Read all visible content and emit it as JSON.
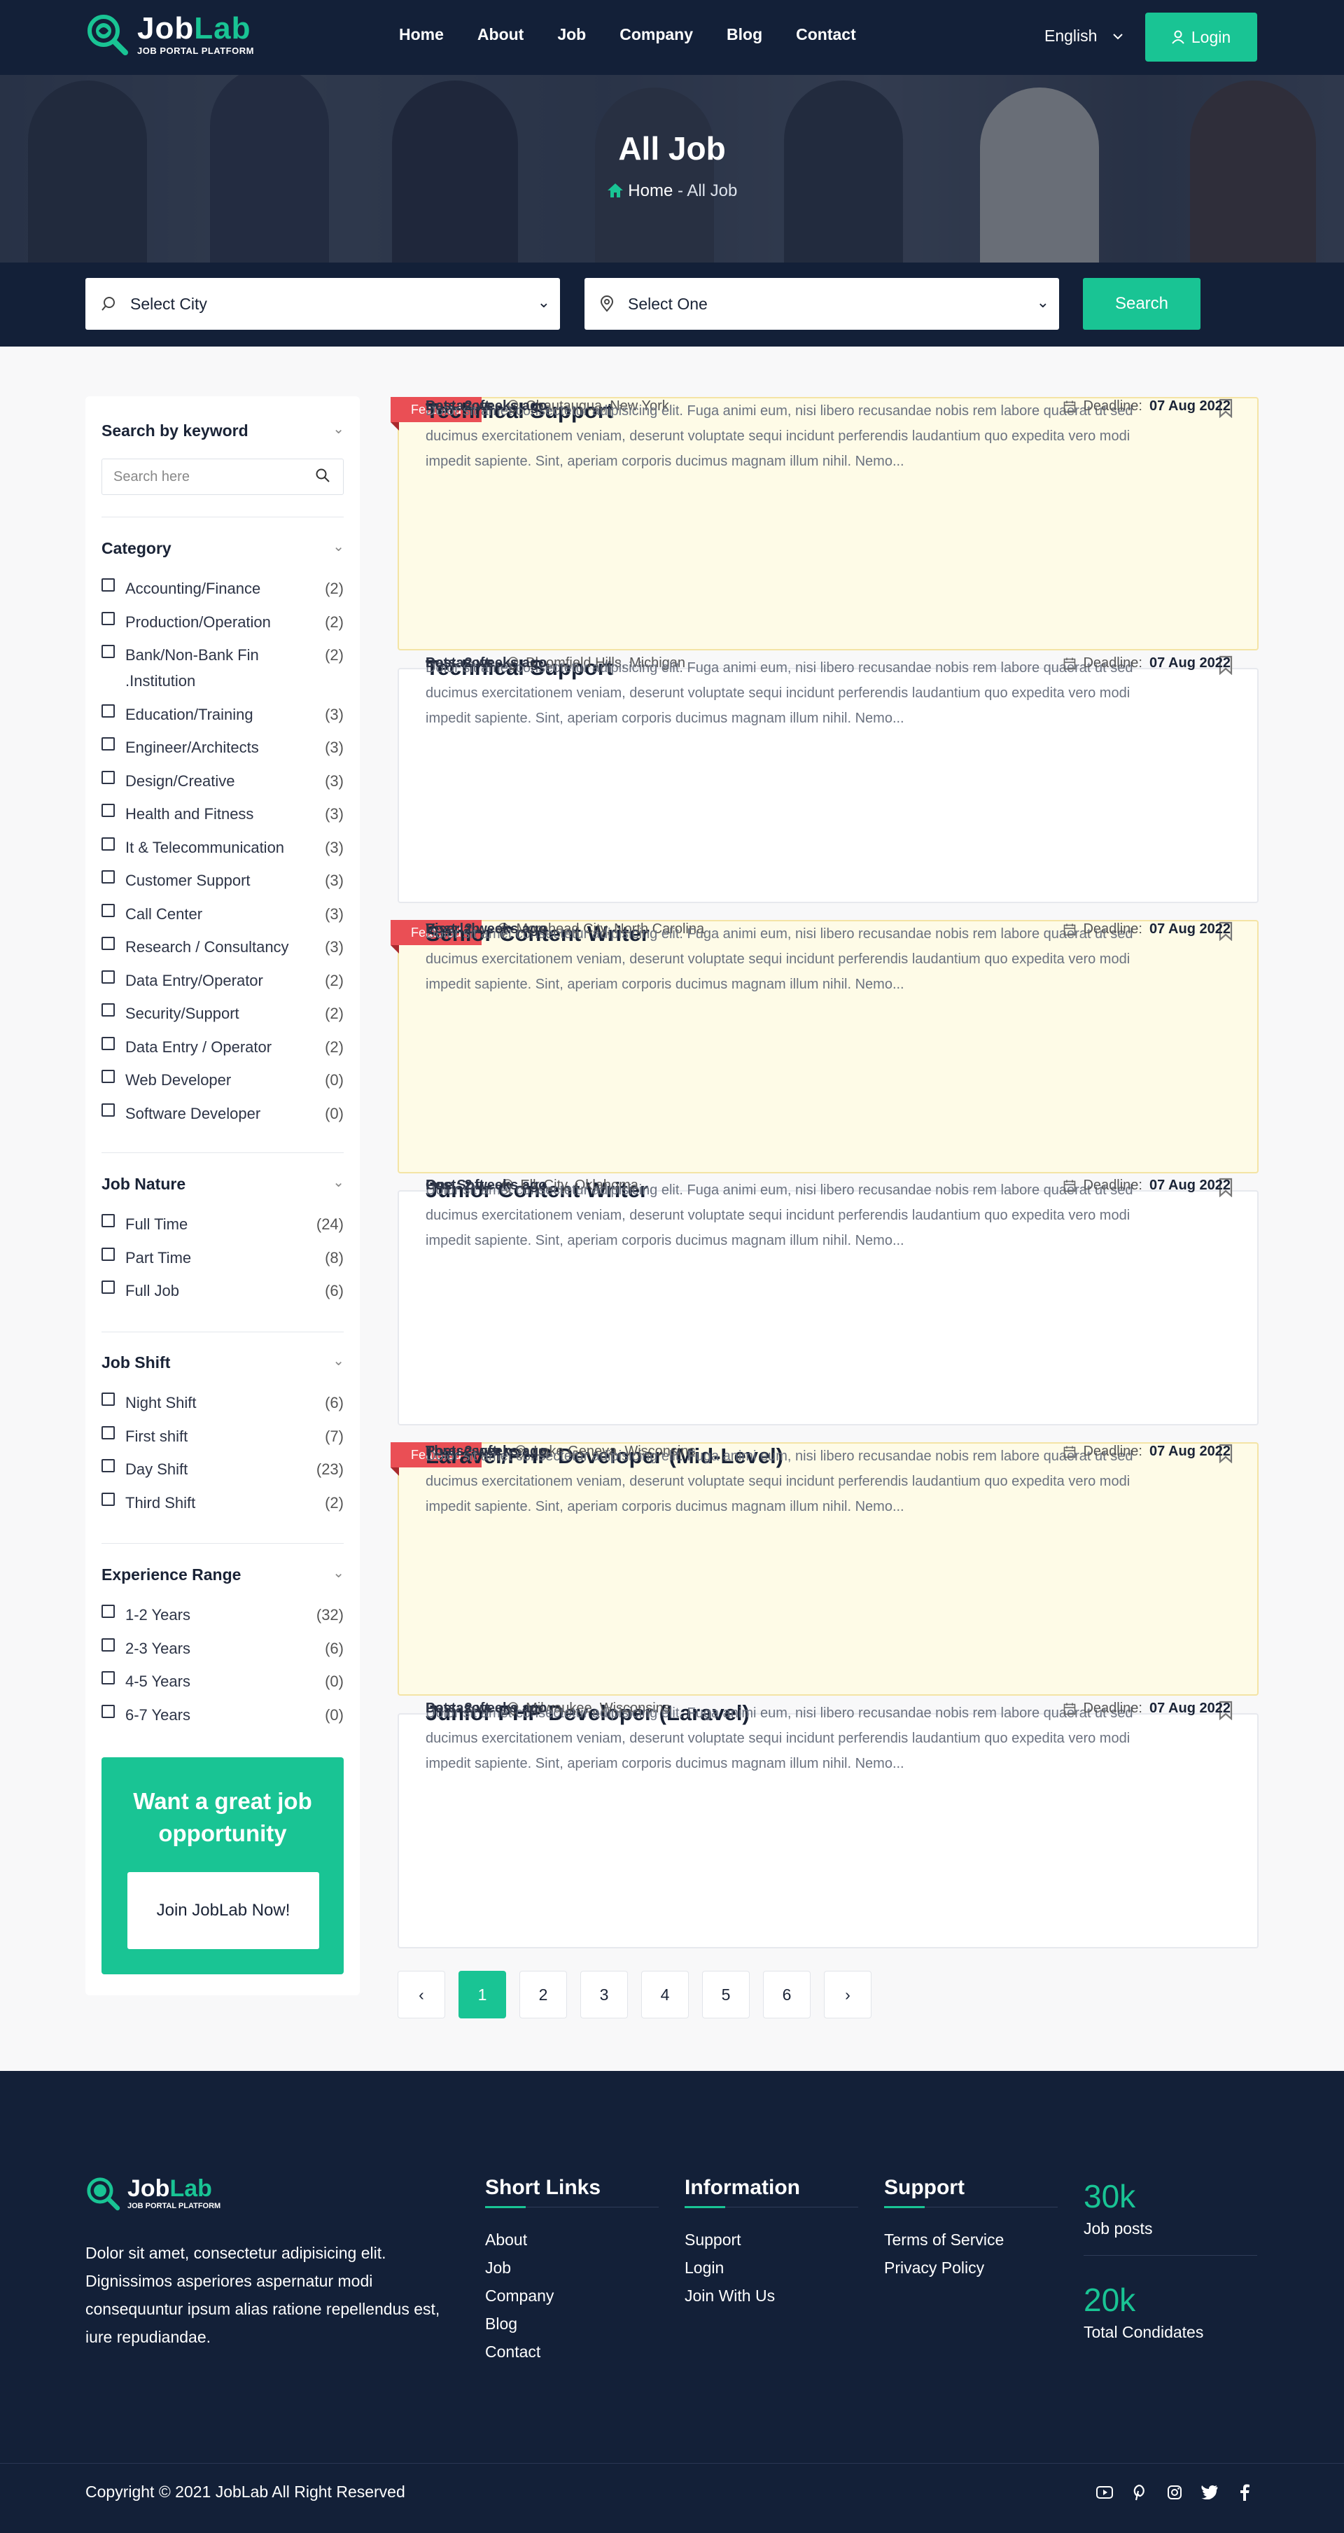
{
  "brand": {
    "name_a": "Job",
    "name_b": "Lab",
    "tagline": "JOB PORTAL PLATFORM",
    "accent": "#19c494",
    "navy": "#132038"
  },
  "nav": [
    {
      "label": "Home"
    },
    {
      "label": "About"
    },
    {
      "label": "Job"
    },
    {
      "label": "Company"
    },
    {
      "label": "Blog"
    },
    {
      "label": "Contact"
    }
  ],
  "header": {
    "language": "English",
    "login": "Login"
  },
  "hero": {
    "title": "All Job",
    "crumb_home": "Home",
    "crumb_sep": " - ",
    "crumb_current": "All Job"
  },
  "search": {
    "city": "Select City",
    "category": "Select One",
    "button": "Search"
  },
  "sidebar": {
    "keyword": {
      "title": "Search by keyword",
      "placeholder": "Search here"
    },
    "category": {
      "title": "Category",
      "items": [
        {
          "label": "Accounting/Finance",
          "count": "(2)"
        },
        {
          "label": "Production/Operation",
          "count": "(2)"
        },
        {
          "label": "Bank/Non-Bank Fin .Institution",
          "count": "(2)"
        },
        {
          "label": "Education/Training",
          "count": "(3)"
        },
        {
          "label": "Engineer/Architects",
          "count": "(3)"
        },
        {
          "label": "Design/Creative",
          "count": "(3)"
        },
        {
          "label": "Health and Fitness",
          "count": "(3)"
        },
        {
          "label": "It & Telecommunication",
          "count": "(3)"
        },
        {
          "label": "Customer Support",
          "count": "(3)"
        },
        {
          "label": "Call Center",
          "count": "(3)"
        },
        {
          "label": "Research / Consultancy",
          "count": "(3)"
        },
        {
          "label": "Data Entry/Operator",
          "count": "(2)"
        },
        {
          "label": "Security/Support",
          "count": "(2)"
        },
        {
          "label": "Data Entry / Operator",
          "count": "(2)"
        },
        {
          "label": "Web Developer",
          "count": "(0)"
        },
        {
          "label": "Software Developer",
          "count": "(0)"
        }
      ]
    },
    "nature": {
      "title": "Job Nature",
      "items": [
        {
          "label": "Full Time",
          "count": "(24)"
        },
        {
          "label": "Part Time",
          "count": "(8)"
        },
        {
          "label": "Full Job",
          "count": "(6)"
        }
      ]
    },
    "shift": {
      "title": "Job Shift",
      "items": [
        {
          "label": "Night Shift",
          "count": "(6)"
        },
        {
          "label": "First shift",
          "count": "(7)"
        },
        {
          "label": "Day Shift",
          "count": "(23)"
        },
        {
          "label": "Third Shift",
          "count": "(2)"
        }
      ]
    },
    "experience": {
      "title": "Experience Range",
      "items": [
        {
          "label": "1-2 Years",
          "count": "(32)"
        },
        {
          "label": "2-3 Years",
          "count": "(6)"
        },
        {
          "label": "4-5 Years",
          "count": "(0)"
        },
        {
          "label": "6-7 Years",
          "count": "(0)"
        }
      ]
    },
    "promo": {
      "title": "Want a great job opportunity",
      "button": "Join JobLab Now!"
    }
  },
  "jobs": [
    {
      "featured": true,
      "badge": "Featured",
      "title": "Technical Support",
      "company": "Datsasoft",
      "location": "Chautauqua, New York",
      "desc": "Dolor sit amet consectetur adipisicing elit. Fuga animi eum, nisi libero recusandae nobis rem labore quaerat ut sed ducimus exercitationem veniam, deserunt voluptate sequi incidunt perferendis laudantium quo expedita vero modi impedit sapiente. Sint, aperiam corporis ducimus magnam illum nihil. Nemo...",
      "posted": "Post: 2 weeks ago",
      "deadline_label": "Deadline:",
      "deadline": "07 Aug 2022"
    },
    {
      "featured": false,
      "badge": "",
      "title": "Technical Support",
      "company": "Datsasoft",
      "location": "Bloomfield Hills, Michigan",
      "desc": "Dolor sit amet consectetur adipisicing elit. Fuga animi eum, nisi libero recusandae nobis rem labore quaerat ut sed ducimus exercitationem veniam, deserunt voluptate sequi incidunt perferendis laudantium quo expedita vero modi impedit sapiente. Sint, aperiam corporis ducimus magnam illum nihil. Nemo...",
      "posted": "Post: 2 weeks ago",
      "deadline_label": "Deadline:",
      "deadline": "07 Aug 2022"
    },
    {
      "featured": true,
      "badge": "Featured",
      "title": "Senior Content Writer",
      "company": "Viserlab",
      "location": "Morehead City, North Carolina",
      "desc": "Dolor sit amet consectetur adipisicing elit. Fuga animi eum, nisi libero recusandae nobis rem labore quaerat ut sed ducimus exercitationem veniam, deserunt voluptate sequi incidunt perferendis laudantium quo expedita vero modi impedit sapiente. Sint, aperiam corporis ducimus magnam illum nihil. Nemo...",
      "posted": "Post: 2 weeks ago",
      "deadline_label": "Deadline:",
      "deadline": "07 Aug 2022"
    },
    {
      "featured": false,
      "badge": "",
      "title": "Junior Content Writer",
      "company": "One Soft",
      "location": "Elk City, Oklahoma",
      "desc": "Dolor sit amet consectetur adipisicing elit. Fuga animi eum, nisi libero recusandae nobis rem labore quaerat ut sed ducimus exercitationem veniam, deserunt voluptate sequi incidunt perferendis laudantium quo expedita vero modi impedit sapiente. Sint, aperiam corporis ducimus magnam illum nihil. Nemo...",
      "posted": "Post: 2 weeks ago",
      "deadline_label": "Deadline:",
      "deadline": "07 Aug 2022"
    },
    {
      "featured": true,
      "badge": "Featured",
      "title": "Laravel/PHP Developer (Mid-Level)",
      "company": "Thresesoft",
      "location": "Lake Geneva, Wisconsins",
      "desc": "Dolor sit amet consectetur adipisicing elit. Fuga animi eum, nisi libero recusandae nobis rem labore quaerat ut sed ducimus exercitationem veniam, deserunt voluptate sequi incidunt perferendis laudantium quo expedita vero modi impedit sapiente. Sint, aperiam corporis ducimus magnam illum nihil. Nemo...",
      "posted": "Post: 2 weeks ago",
      "deadline_label": "Deadline:",
      "deadline": "07 Aug 2022"
    },
    {
      "featured": false,
      "badge": "",
      "title": "Junior PHP Developer (Laravel)",
      "company": "Datsasoft",
      "location": "Milwaukee, Wisconsins",
      "desc": "Dolor sit amet consectetur adipisicing elit. Fuga animi eum, nisi libero recusandae nobis rem labore quaerat ut sed ducimus exercitationem veniam, deserunt voluptate sequi incidunt perferendis laudantium quo expedita vero modi impedit sapiente. Sint, aperiam corporis ducimus magnam illum nihil. Nemo...",
      "posted": "Post: 2 weeks ago",
      "deadline_label": "Deadline:",
      "deadline": "07 Aug 2022"
    }
  ],
  "pagination": {
    "prev": "‹",
    "pages": [
      "1",
      "2",
      "3",
      "4",
      "5",
      "6"
    ],
    "current": "1",
    "next": "›"
  },
  "footer": {
    "desc": "Dolor sit amet, consectetur adipisicing elit. Dignissimos asperiores aspernatur modi consequuntur ipsum alias ratione repellendus est, iure repudiandae.",
    "short_links": {
      "title": "Short Links",
      "links": [
        "About",
        "Job",
        "Company",
        "Blog",
        "Contact"
      ]
    },
    "information": {
      "title": "Information",
      "links": [
        "Support",
        "Login",
        "Join With Us"
      ]
    },
    "support": {
      "title": "Support",
      "links": [
        "Terms of Service",
        "Privacy Policy"
      ]
    },
    "stats": [
      {
        "value": "30k",
        "label": "Job posts"
      },
      {
        "value": "20k",
        "label": "Total Condidates"
      }
    ],
    "copyright": "Copyright © 2021 JobLab All Right Reserved",
    "social": [
      "youtube-icon",
      "pinterest-icon",
      "instagram-icon",
      "twitter-icon",
      "facebook-icon"
    ]
  }
}
